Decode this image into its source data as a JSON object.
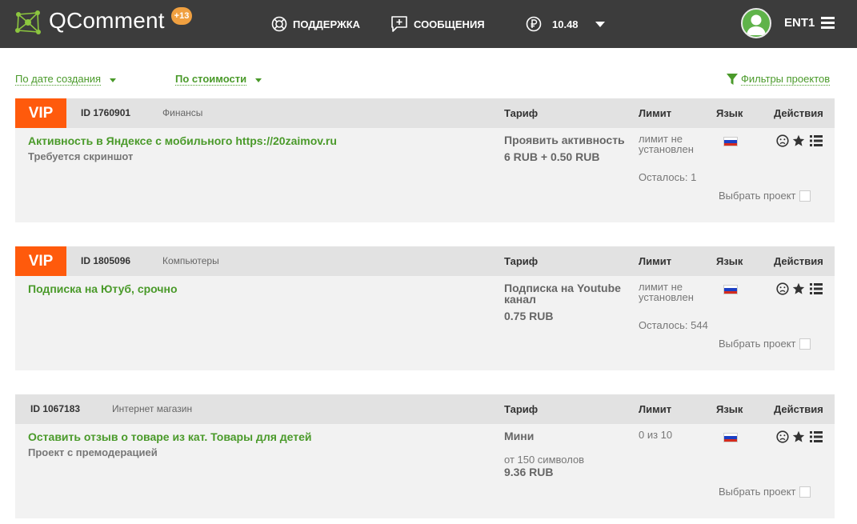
{
  "header": {
    "brand": "QComment",
    "brand_badge": "+13",
    "support_label": "ПОДДЕРЖКА",
    "messages_label": "СООБЩЕНИЯ",
    "balance": "10.48",
    "username": "ENT1"
  },
  "sort": {
    "by_date": "По дате создания",
    "by_cost": "По стоимости",
    "filters": "Фильтры проектов"
  },
  "columns": {
    "tariff": "Тариф",
    "limit": "Лимит",
    "language": "Язык",
    "actions": "Действия"
  },
  "select_label": "Выбрать проект",
  "projects": [
    {
      "vip": "VIP",
      "id": "ID 1760901",
      "category": "Финансы",
      "title": "Активность в Яндексе с мобильного https://20zaimov.ru",
      "subtitle": "Требуется скриншот",
      "tariff": "Проявить активность",
      "price": "6 RUB + 0.50 RUB",
      "limit": "лимит не установлен",
      "remaining": "Осталось: 1"
    },
    {
      "vip": "VIP",
      "id": "ID 1805096",
      "category": "Компьютеры",
      "title": "Подписка на Ютуб, срочно",
      "subtitle": "",
      "tariff": "Подписка на Youtube канал",
      "price": "0.75 RUB",
      "limit": "лимит не установлен",
      "remaining": "Осталось: 544"
    },
    {
      "vip": "",
      "id": "ID 1067183",
      "category": "Интернет магазин",
      "title": "Оставить отзыв о товаре из кат. Товары для детей",
      "subtitle": "Проект с премодерацией",
      "tariff": "Мини",
      "tariff_note": "от 150 символов",
      "price": "9.36 RUB",
      "limit": "0 из 10",
      "remaining": ""
    }
  ],
  "colors": {
    "topbar": "#3c3c3c",
    "accent_green": "#4a9a2a",
    "vip_orange": "#ff5a0c",
    "badge_orange": "#f0a040"
  },
  "icons": {
    "logo": "network-logo-icon",
    "support": "lifebuoy-icon",
    "messages": "message-plus-icon",
    "balance": "ruble-icon",
    "menu": "hamburger-icon",
    "filter": "funnel-icon",
    "actions": [
      "sad-face-icon",
      "star-icon",
      "list-icon"
    ]
  }
}
